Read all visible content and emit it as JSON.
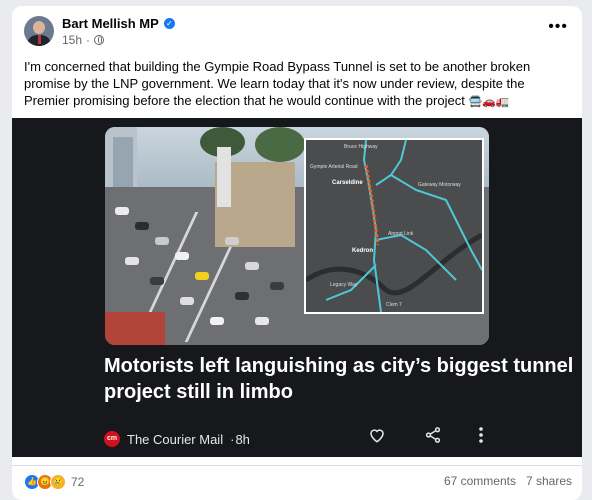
{
  "post": {
    "author": "Bart Mellish MP",
    "time": "15h",
    "body": "I'm concerned that building the Gympie Road Bypass Tunnel is set to be another broken promise by the LNP government. We learn today that it's now under review, despite the Premier promising before the election that he would continue with the project",
    "emojis": "🚍🚗🚛"
  },
  "card": {
    "headline": "Motorists left languishing as city’s biggest tunnel project still in limbo",
    "source": "The Courier Mail",
    "age": "8h",
    "logo_text": "cm",
    "map_labels": {
      "bruce": "Bruce Highway",
      "gympie_arterial": "Gympie Arterial Road",
      "carseldine": "Carseldine",
      "gateway": "Gateway Motorway",
      "airport": "Airport Link",
      "kedron": "Kedron",
      "legacy": "Legacy Way",
      "clem": "Clem 7"
    }
  },
  "stats": {
    "reactions": "72",
    "comments": "67 comments",
    "shares": "7 shares"
  },
  "colors": {
    "accent": "#1877f2",
    "route": "#e8622a",
    "roads": "#4fc8d6"
  }
}
